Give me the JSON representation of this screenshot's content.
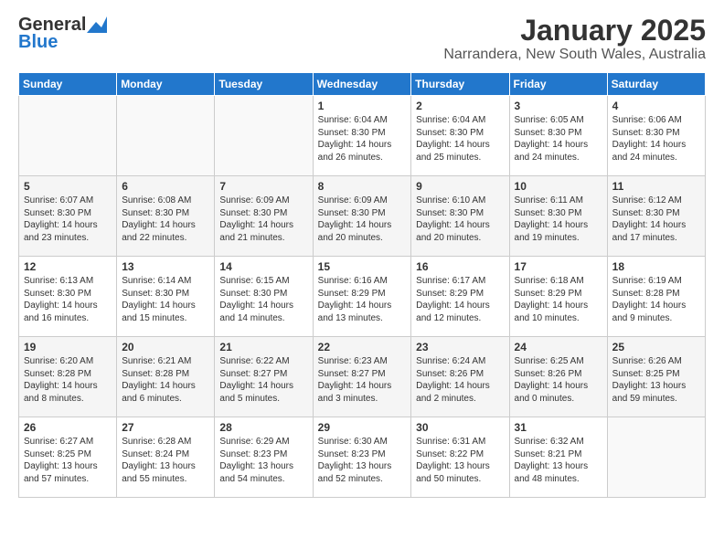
{
  "header": {
    "logo_line1": "General",
    "logo_line2": "Blue",
    "title": "January 2025",
    "subtitle": "Narrandera, New South Wales, Australia"
  },
  "calendar": {
    "weekdays": [
      "Sunday",
      "Monday",
      "Tuesday",
      "Wednesday",
      "Thursday",
      "Friday",
      "Saturday"
    ],
    "weeks": [
      [
        {
          "day": "",
          "info": ""
        },
        {
          "day": "",
          "info": ""
        },
        {
          "day": "",
          "info": ""
        },
        {
          "day": "1",
          "info": "Sunrise: 6:04 AM\nSunset: 8:30 PM\nDaylight: 14 hours\nand 26 minutes."
        },
        {
          "day": "2",
          "info": "Sunrise: 6:04 AM\nSunset: 8:30 PM\nDaylight: 14 hours\nand 25 minutes."
        },
        {
          "day": "3",
          "info": "Sunrise: 6:05 AM\nSunset: 8:30 PM\nDaylight: 14 hours\nand 24 minutes."
        },
        {
          "day": "4",
          "info": "Sunrise: 6:06 AM\nSunset: 8:30 PM\nDaylight: 14 hours\nand 24 minutes."
        }
      ],
      [
        {
          "day": "5",
          "info": "Sunrise: 6:07 AM\nSunset: 8:30 PM\nDaylight: 14 hours\nand 23 minutes."
        },
        {
          "day": "6",
          "info": "Sunrise: 6:08 AM\nSunset: 8:30 PM\nDaylight: 14 hours\nand 22 minutes."
        },
        {
          "day": "7",
          "info": "Sunrise: 6:09 AM\nSunset: 8:30 PM\nDaylight: 14 hours\nand 21 minutes."
        },
        {
          "day": "8",
          "info": "Sunrise: 6:09 AM\nSunset: 8:30 PM\nDaylight: 14 hours\nand 20 minutes."
        },
        {
          "day": "9",
          "info": "Sunrise: 6:10 AM\nSunset: 8:30 PM\nDaylight: 14 hours\nand 20 minutes."
        },
        {
          "day": "10",
          "info": "Sunrise: 6:11 AM\nSunset: 8:30 PM\nDaylight: 14 hours\nand 19 minutes."
        },
        {
          "day": "11",
          "info": "Sunrise: 6:12 AM\nSunset: 8:30 PM\nDaylight: 14 hours\nand 17 minutes."
        }
      ],
      [
        {
          "day": "12",
          "info": "Sunrise: 6:13 AM\nSunset: 8:30 PM\nDaylight: 14 hours\nand 16 minutes."
        },
        {
          "day": "13",
          "info": "Sunrise: 6:14 AM\nSunset: 8:30 PM\nDaylight: 14 hours\nand 15 minutes."
        },
        {
          "day": "14",
          "info": "Sunrise: 6:15 AM\nSunset: 8:30 PM\nDaylight: 14 hours\nand 14 minutes."
        },
        {
          "day": "15",
          "info": "Sunrise: 6:16 AM\nSunset: 8:29 PM\nDaylight: 14 hours\nand 13 minutes."
        },
        {
          "day": "16",
          "info": "Sunrise: 6:17 AM\nSunset: 8:29 PM\nDaylight: 14 hours\nand 12 minutes."
        },
        {
          "day": "17",
          "info": "Sunrise: 6:18 AM\nSunset: 8:29 PM\nDaylight: 14 hours\nand 10 minutes."
        },
        {
          "day": "18",
          "info": "Sunrise: 6:19 AM\nSunset: 8:28 PM\nDaylight: 14 hours\nand 9 minutes."
        }
      ],
      [
        {
          "day": "19",
          "info": "Sunrise: 6:20 AM\nSunset: 8:28 PM\nDaylight: 14 hours\nand 8 minutes."
        },
        {
          "day": "20",
          "info": "Sunrise: 6:21 AM\nSunset: 8:28 PM\nDaylight: 14 hours\nand 6 minutes."
        },
        {
          "day": "21",
          "info": "Sunrise: 6:22 AM\nSunset: 8:27 PM\nDaylight: 14 hours\nand 5 minutes."
        },
        {
          "day": "22",
          "info": "Sunrise: 6:23 AM\nSunset: 8:27 PM\nDaylight: 14 hours\nand 3 minutes."
        },
        {
          "day": "23",
          "info": "Sunrise: 6:24 AM\nSunset: 8:26 PM\nDaylight: 14 hours\nand 2 minutes."
        },
        {
          "day": "24",
          "info": "Sunrise: 6:25 AM\nSunset: 8:26 PM\nDaylight: 14 hours\nand 0 minutes."
        },
        {
          "day": "25",
          "info": "Sunrise: 6:26 AM\nSunset: 8:25 PM\nDaylight: 13 hours\nand 59 minutes."
        }
      ],
      [
        {
          "day": "26",
          "info": "Sunrise: 6:27 AM\nSunset: 8:25 PM\nDaylight: 13 hours\nand 57 minutes."
        },
        {
          "day": "27",
          "info": "Sunrise: 6:28 AM\nSunset: 8:24 PM\nDaylight: 13 hours\nand 55 minutes."
        },
        {
          "day": "28",
          "info": "Sunrise: 6:29 AM\nSunset: 8:23 PM\nDaylight: 13 hours\nand 54 minutes."
        },
        {
          "day": "29",
          "info": "Sunrise: 6:30 AM\nSunset: 8:23 PM\nDaylight: 13 hours\nand 52 minutes."
        },
        {
          "day": "30",
          "info": "Sunrise: 6:31 AM\nSunset: 8:22 PM\nDaylight: 13 hours\nand 50 minutes."
        },
        {
          "day": "31",
          "info": "Sunrise: 6:32 AM\nSunset: 8:21 PM\nDaylight: 13 hours\nand 48 minutes."
        },
        {
          "day": "",
          "info": ""
        }
      ]
    ]
  }
}
